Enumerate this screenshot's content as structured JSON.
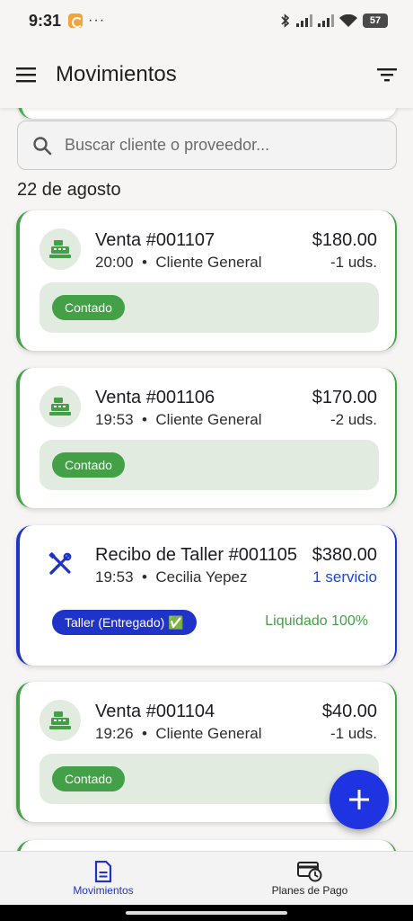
{
  "status_bar": {
    "time": "9:31",
    "dots": "···",
    "battery": "57"
  },
  "app_bar": {
    "title": "Movimientos"
  },
  "search": {
    "placeholder": "Buscar cliente o proveedor..."
  },
  "date_header": "22 de agosto",
  "movements": [
    {
      "type": "sale",
      "title": "Venta #001107",
      "time": "20:00",
      "party": "Cliente General",
      "amount": "$180.00",
      "qty": "-1 uds.",
      "badge": "Contado"
    },
    {
      "type": "sale",
      "title": "Venta #001106",
      "time": "19:53",
      "party": "Cliente General",
      "amount": "$170.00",
      "qty": "-2 uds.",
      "badge": "Contado"
    },
    {
      "type": "workshop",
      "title": "Recibo de Taller #001105",
      "time": "19:53",
      "party": "Cecilia Yepez",
      "amount": "$380.00",
      "qty": "1 servicio",
      "badge": "Taller (Entregado) ✅",
      "status": "Liquidado 100%"
    },
    {
      "type": "sale",
      "title": "Venta #001104",
      "time": "19:26",
      "party": "Cliente General",
      "amount": "$40.00",
      "qty": "-1 uds.",
      "badge": "Contado"
    }
  ],
  "separator": "•",
  "bottom_nav": {
    "movements_label": "Movimientos",
    "payment_plans_label": "Planes de Pago"
  },
  "colors": {
    "sale_accent": "#43a047",
    "workshop_accent": "#1f33c9",
    "fab": "#1f33e0"
  }
}
